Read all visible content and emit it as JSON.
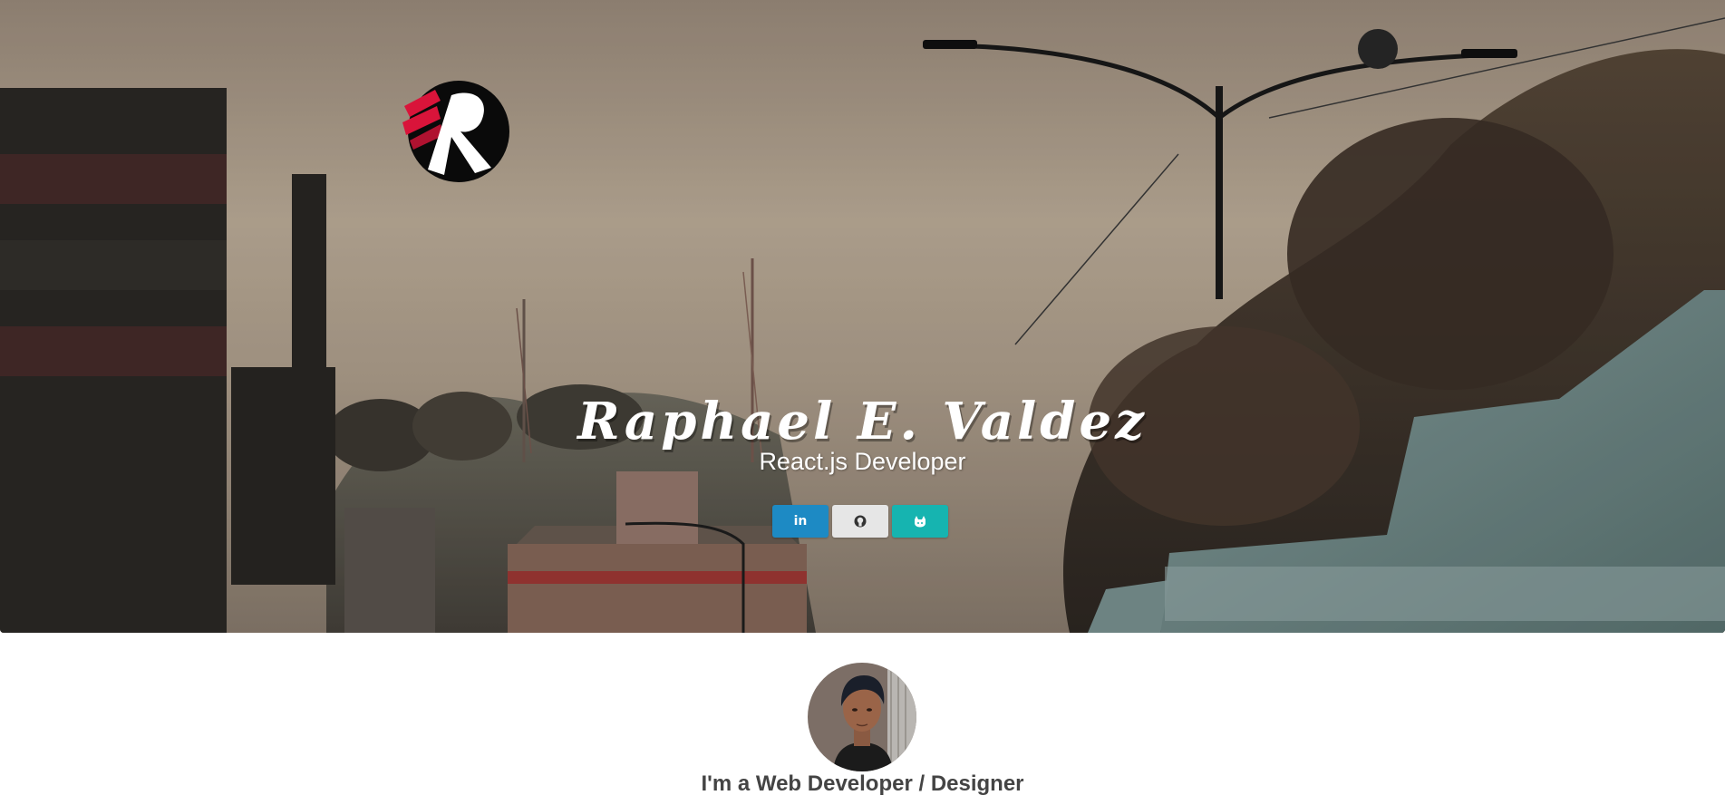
{
  "hero": {
    "name": "Raphael E. Valdez",
    "role": "React.js Developer",
    "logo_letter": "R"
  },
  "social": [
    {
      "label": "in",
      "icon": "linkedin-icon",
      "color": "#1d8ac4"
    },
    {
      "label": "",
      "icon": "github-icon",
      "color": "#e6e6e6"
    },
    {
      "label": "",
      "icon": "gitlab-icon",
      "color": "#16b4b0"
    }
  ],
  "about": {
    "heading": "I'm a Web Developer / Designer"
  }
}
